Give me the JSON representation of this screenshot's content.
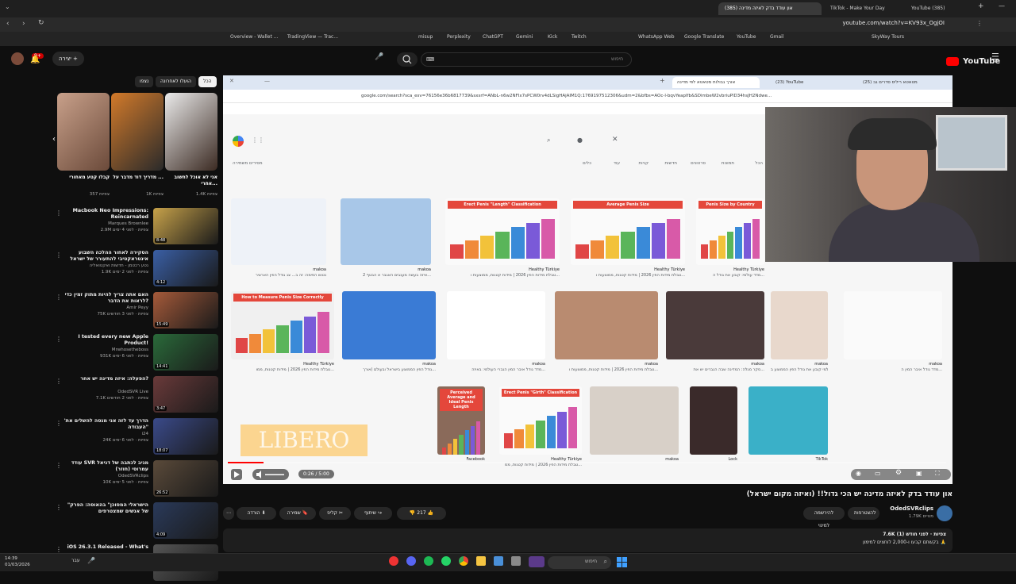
{
  "outer_tabs": [
    {
      "label": "YouTube (385)"
    },
    {
      "label": "TikTok - Make Your Day"
    },
    {
      "label": "(385) און עודד בדק לאיזה מדינה"
    }
  ],
  "outer_url": "youtube.com/watch?v=KV93x_OgjOI",
  "bookmarks": [
    "Overview - Wallet ...",
    "TradingView — Trac...",
    "misup",
    "Perplexity",
    "ChatGPT",
    "Gemini",
    "Kick",
    "Twitch",
    "WhatsApp Web",
    "Google Translate",
    "YouTube",
    "Gmail",
    "SkyWay Tours"
  ],
  "yt_header": {
    "logo": "YouTube",
    "search_placeholder": "חיפוש",
    "create_label": "יצירה",
    "notif_count": "9+"
  },
  "chips": [
    "הכל",
    "הועלו לאחרונה",
    "נצפו"
  ],
  "shorts": [
    {
      "title": "אני לא אוכל לחשוב אחרי...",
      "views": "1.4K צפיות"
    },
    {
      "title": "מדריך דוד מדבר על ...",
      "views": "1K צפיות"
    },
    {
      "title": "קבלו קטע מאחורי",
      "views": "357 צפיות"
    }
  ],
  "recommended": [
    {
      "title": "Macbook Neo Impressions: Reincarnated",
      "channel": "Marques Brownlee",
      "meta": "2.9M צפיות · לפני 4 ימים",
      "duration": "8:48"
    },
    {
      "title": "הסקירה לאחור ההלכה השבוע אינטראקטיבי להתעורר של ישראל",
      "channel": "נטע רכטמן - חדשות ואקטואליה",
      "meta": "1.9K צפיות · לפני 2 ימים",
      "duration": "4:12"
    },
    {
      "title": "האם אתה צריך להיות מתוק זמין כדי לראות את הדבר?",
      "channel": "Amir Peyy",
      "meta": "75K צפיות · לפני 3 חודשים",
      "duration": "15:49"
    },
    {
      "title": "I tested every new Apple Product!",
      "channel": "Mrwhosetheboss",
      "meta": "931K צפיות · לפני 6 ימים",
      "duration": "14:41"
    },
    {
      "title": "הפעלה: איזה מדינה יש אחר?",
      "channel": "OdedSVR Live",
      "meta": "7.1K צפיות · לפני 2 חודשים",
      "duration": "3:47"
    },
    {
      "title": "'הדרך עד לזה אני מנסה להשלים את העבודה\"",
      "channel": "i24",
      "meta": "24K צפיות · לפני 6 ימים",
      "duration": "18:07"
    },
    {
      "title": "עודד SVR מגיב לכתבה של דניאל עמרוסי (חוזר)",
      "channel": "OdedSVRclips",
      "meta": "10K צפיות · לפני 5 ימים",
      "duration": "26:52"
    },
    {
      "title": "\"הישראלי המסוכן\" בהאוסה: הפרק של אנשים שמצטרפים",
      "channel": "",
      "meta": "",
      "duration": "4:09"
    },
    {
      "title": "iOS 26.3.1 Released - What's",
      "channel": "",
      "meta": "",
      "duration": ""
    }
  ],
  "inner_tabs": [
    {
      "label": "(25) מטאטא ריליס סדרים גב"
    },
    {
      "label": "(23) YouTube"
    },
    {
      "label": "אורך גבולות מטאטא לפי מדינה"
    }
  ],
  "google_url": "google.com/search?sca_esv=76156e36b6817739&sxsrf=ANbL-n6w2NFIx7sPCW0rv4dLSigHAjAIM1Q:1769197512306&udm=2&bfbs=AOc-l-bqvYeaplfb&SDimbeW2vbriuPlD34hsJH2Ndwe...",
  "google": {
    "filters": [
      "הכל",
      "תמונות",
      "סרטונים",
      "חדשות",
      "קניות",
      "עוד",
      "כלים"
    ],
    "safe_search": "מסירים משמירה"
  },
  "images": [
    {
      "caption": "נטוש הפימה: זה ב... צג גודל הפין הארציר",
      "source": "makoa"
    },
    {
      "caption": "איזה בעשה מעגבים האגבר א הבטף 2...",
      "source": "makoa"
    },
    {
      "caption": "טבלת מידות הפין 2026 | מידות קטנות, ממוצעות ו...",
      "source": "Healthy Türkiye",
      "heading": "Erect Penis \"Length\" Classification"
    },
    {
      "caption": "טבלת מידות הפין 2026 | מידות קטנות, ממוצעות ו...",
      "source": "Healthy Türkiye",
      "heading": "Average Penis Size"
    },
    {
      "caption": "מדד עולמי: קובע את גודל ה...",
      "source": "Healthy Türkiye",
      "heading": "Penis Size by Country"
    },
    {
      "caption": "טבלת מידות הפין 2026 | מידות קטנות, ממו...",
      "source": "Healthy Türkiye",
      "heading": "How to Measure Penis Size Correctly"
    },
    {
      "caption": "גודל הפין הממוצע בישראל ובעולם (אורך...",
      "source": "makoa"
    },
    {
      "caption": "מדד גודל איבר המין הגברי העולמי: באיזה...",
      "source": "makoa"
    },
    {
      "caption": "טבלת מידות הפין 2026 | מידות קטנות, ממוצעות ו...",
      "source": "makoa"
    },
    {
      "caption": "סקר מגלה: המדינה שבה הגברים יש את...",
      "source": "makoa"
    },
    {
      "caption": "מדד עולמי קובע את גודל הפין הממוצע ב...",
      "source": "makoa"
    },
    {
      "caption": "מדד גודל איבר המין ה...",
      "source": "makoa"
    },
    {
      "caption": "טבלת מידות הפין 2026 | מידות קטנות, ממ...",
      "source": "Healthy Türkiye",
      "heading": "Erect Penis \"Girth\" Classification"
    },
    {
      "caption": "",
      "source": "Facebook",
      "heading": "Perceived Average and Ideal Penis Length"
    },
    {
      "caption": "",
      "source": "makoa"
    },
    {
      "caption": "",
      "source": "Lock"
    },
    {
      "caption": "",
      "source": "TikTok"
    }
  ],
  "player": {
    "time": "0:26 / 5:00",
    "progress_fraction": 0.05,
    "overlay_text": "LIBERO"
  },
  "video": {
    "title": "און עודד בדק לאיזה מדינה יש הכי גדול!! (ואיזה מקום ישראל)",
    "channel": "OdedSVRclips",
    "subscribers": "1.79K מנויים",
    "subscribe_label": "להצטרפות",
    "join_label": "להירשמה למינוי",
    "likes": "217",
    "share_label": "שיתוף",
    "clip_label": "קליפ",
    "save_label": "שמירה",
    "download_label": "הורדה",
    "views": "7.6K צפיות · לפני חודש (1)",
    "desc_line": "בקשתם קבעו ו-2,000 לוחצים למימון 🙏"
  },
  "taskbar": {
    "time": "14:39",
    "date": "01/03/2026",
    "search_label": "חיפוש",
    "lang": "עבר"
  }
}
